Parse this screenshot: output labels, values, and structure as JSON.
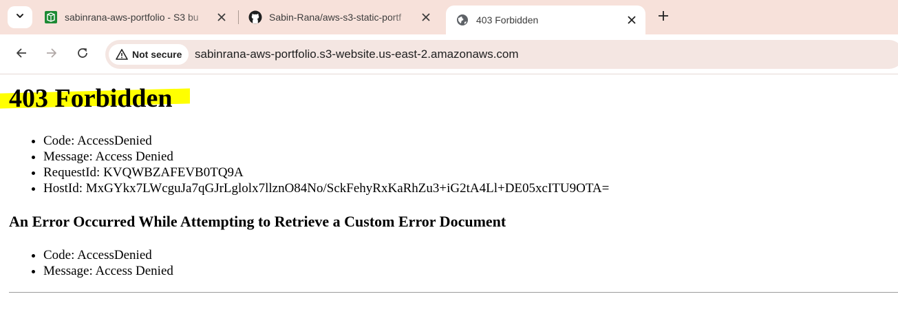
{
  "browser": {
    "tabs": [
      {
        "title": "sabinrana-aws-portfolio - S3 bu",
        "favicon": "aws-s3-icon",
        "active": false
      },
      {
        "title": "Sabin-Rana/aws-s3-static-portf",
        "favicon": "github-icon",
        "active": false
      },
      {
        "title": "403 Forbidden",
        "favicon": "globe-icon",
        "active": true
      }
    ],
    "security_label": "Not secure",
    "url": "sabinrana-aws-portfolio.s3-website.us-east-2.amazonaws.com"
  },
  "page": {
    "heading": "403 Forbidden",
    "details": [
      "Code: AccessDenied",
      "Message: Access Denied",
      "RequestId: KVQWBZAFEVB0TQ9A",
      "HostId: MxGYkx7LWcguJa7qGJrLglolx7llznO84No/SckFehyRxKaRhZu3+iG2tA4Ll+DE05xcITU9OTA="
    ],
    "subheading": "An Error Occurred While Attempting to Retrieve a Custom Error Document",
    "sub_details": [
      "Code: AccessDenied",
      "Message: Access Denied"
    ]
  },
  "colors": {
    "tab_strip": "#f7e1da",
    "highlight": "#ffff00",
    "aws_green": "#1d8a34"
  }
}
